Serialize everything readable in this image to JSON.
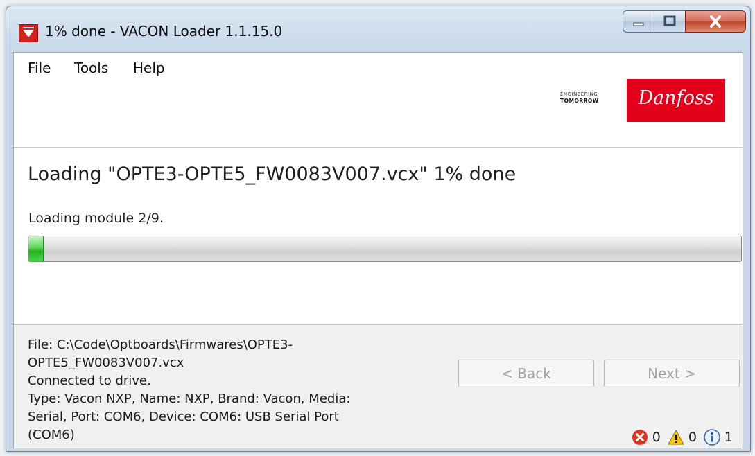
{
  "window": {
    "title": "1% done - VACON Loader 1.1.15.0",
    "controls": {
      "minimize": "minimize",
      "maximize": "maximize",
      "close": "close"
    }
  },
  "menu": {
    "items": [
      {
        "label": "File"
      },
      {
        "label": "Tools"
      },
      {
        "label": "Help"
      }
    ]
  },
  "brand": {
    "tagline_line1": "ENGINEERING",
    "tagline_line2": "TOMORROW",
    "logo_text": "Danfoss",
    "logo_color": "#e2001a"
  },
  "main": {
    "heading": "Loading \"OPTE3-OPTE5_FW0083V007.vcx\" 1% done",
    "status": "Loading module 2/9.",
    "progress_percent": 1,
    "progress_color": "#2fbf2f"
  },
  "footer": {
    "info_lines": [
      "File: C:\\Code\\Optboards\\Firmwares\\OPTE3-",
      "OPTE5_FW0083V007.vcx",
      "Connected to drive.",
      "Type: Vacon NXP, Name: NXP, Brand: Vacon, Media:",
      "Serial, Port: COM6, Device: COM6: USB Serial Port",
      "(COM6)"
    ],
    "back_label": "< Back",
    "next_label": "Next >",
    "counters": {
      "errors": "0",
      "warnings": "0",
      "info": "1"
    }
  }
}
